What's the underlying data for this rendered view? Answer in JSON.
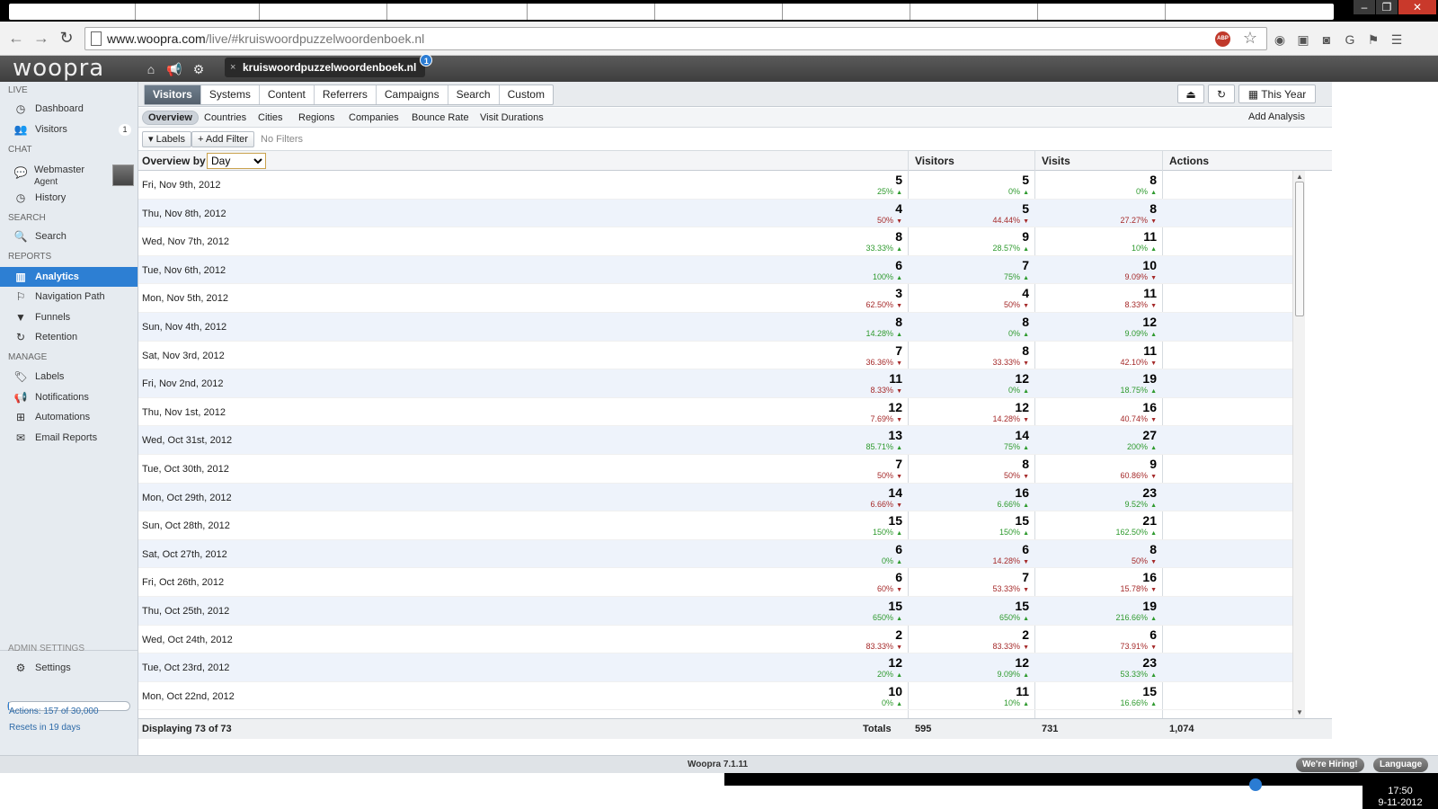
{
  "browser": {
    "url_host": "www.woopra.com",
    "url_path": "/live/#kruiswoordpuzzelwoordenboek.nl"
  },
  "app": {
    "logo": "woopra",
    "site_tab": "kruiswoordpuzzelwoordenboek.nl",
    "site_tab_badge": "1"
  },
  "sidebar": {
    "sections": {
      "live": "LIVE",
      "chat": "CHAT",
      "search": "SEARCH",
      "reports": "REPORTS",
      "manage": "MANAGE",
      "admin": "ADMIN SETTINGS"
    },
    "items": {
      "dashboard": "Dashboard",
      "visitors": "Visitors",
      "visitors_count": "1",
      "agent_line1": "Webmaster",
      "agent_line2": "Agent",
      "history": "History",
      "search": "Search",
      "analytics": "Analytics",
      "navigation_path": "Navigation Path",
      "funnels": "Funnels",
      "retention": "Retention",
      "labels": "Labels",
      "notifications": "Notifications",
      "automations": "Automations",
      "email_reports": "Email Reports",
      "settings": "Settings"
    },
    "quota": {
      "actions": "Actions: 157 of 30,000",
      "resets": "Resets in 19 days",
      "used_fraction": 0.005
    }
  },
  "tabs": {
    "visitors": "Visitors",
    "systems": "Systems",
    "content": "Content",
    "referrers": "Referrers",
    "campaigns": "Campaigns",
    "search": "Search",
    "custom": "Custom",
    "range": "This Year"
  },
  "subtabs": {
    "overview": "Overview",
    "countries": "Countries",
    "cities": "Cities",
    "regions": "Regions",
    "companies": "Companies",
    "bounce_rate": "Bounce Rate",
    "visit_durations": "Visit Durations",
    "add_analysis": "Add Analysis"
  },
  "filters": {
    "labels": "Labels",
    "add_filter": "Add Filter",
    "no_filters": "No Filters"
  },
  "table": {
    "overview_by": "Overview by",
    "group_by_selected": "Day",
    "columns": [
      "Visitors",
      "Visits",
      "Actions"
    ],
    "rows": [
      {
        "date": "Fri, Nov 9th, 2012",
        "visitors": [
          "5",
          "25%",
          "up"
        ],
        "visits": [
          "5",
          "0%",
          "up"
        ],
        "actions": [
          "8",
          "0%",
          "up"
        ]
      },
      {
        "date": "Thu, Nov 8th, 2012",
        "visitors": [
          "4",
          "50%",
          "down"
        ],
        "visits": [
          "5",
          "44.44%",
          "down"
        ],
        "actions": [
          "8",
          "27.27%",
          "down"
        ]
      },
      {
        "date": "Wed, Nov 7th, 2012",
        "visitors": [
          "8",
          "33.33%",
          "up"
        ],
        "visits": [
          "9",
          "28.57%",
          "up"
        ],
        "actions": [
          "11",
          "10%",
          "up"
        ]
      },
      {
        "date": "Tue, Nov 6th, 2012",
        "visitors": [
          "6",
          "100%",
          "up"
        ],
        "visits": [
          "7",
          "75%",
          "up"
        ],
        "actions": [
          "10",
          "9.09%",
          "down"
        ]
      },
      {
        "date": "Mon, Nov 5th, 2012",
        "visitors": [
          "3",
          "62.50%",
          "down"
        ],
        "visits": [
          "4",
          "50%",
          "down"
        ],
        "actions": [
          "11",
          "8.33%",
          "down"
        ]
      },
      {
        "date": "Sun, Nov 4th, 2012",
        "visitors": [
          "8",
          "14.28%",
          "up"
        ],
        "visits": [
          "8",
          "0%",
          "up"
        ],
        "actions": [
          "12",
          "9.09%",
          "up"
        ]
      },
      {
        "date": "Sat, Nov 3rd, 2012",
        "visitors": [
          "7",
          "36.36%",
          "down"
        ],
        "visits": [
          "8",
          "33.33%",
          "down"
        ],
        "actions": [
          "11",
          "42.10%",
          "down"
        ]
      },
      {
        "date": "Fri, Nov 2nd, 2012",
        "visitors": [
          "11",
          "8.33%",
          "down"
        ],
        "visits": [
          "12",
          "0%",
          "up"
        ],
        "actions": [
          "19",
          "18.75%",
          "up"
        ]
      },
      {
        "date": "Thu, Nov 1st, 2012",
        "visitors": [
          "12",
          "7.69%",
          "down"
        ],
        "visits": [
          "12",
          "14.28%",
          "down"
        ],
        "actions": [
          "16",
          "40.74%",
          "down"
        ]
      },
      {
        "date": "Wed, Oct 31st, 2012",
        "visitors": [
          "13",
          "85.71%",
          "up"
        ],
        "visits": [
          "14",
          "75%",
          "up"
        ],
        "actions": [
          "27",
          "200%",
          "up"
        ]
      },
      {
        "date": "Tue, Oct 30th, 2012",
        "visitors": [
          "7",
          "50%",
          "down"
        ],
        "visits": [
          "8",
          "50%",
          "down"
        ],
        "actions": [
          "9",
          "60.86%",
          "down"
        ]
      },
      {
        "date": "Mon, Oct 29th, 2012",
        "visitors": [
          "14",
          "6.66%",
          "down"
        ],
        "visits": [
          "16",
          "6.66%",
          "up"
        ],
        "actions": [
          "23",
          "9.52%",
          "up"
        ]
      },
      {
        "date": "Sun, Oct 28th, 2012",
        "visitors": [
          "15",
          "150%",
          "up"
        ],
        "visits": [
          "15",
          "150%",
          "up"
        ],
        "actions": [
          "21",
          "162.50%",
          "up"
        ]
      },
      {
        "date": "Sat, Oct 27th, 2012",
        "visitors": [
          "6",
          "0%",
          "up"
        ],
        "visits": [
          "6",
          "14.28%",
          "down"
        ],
        "actions": [
          "8",
          "50%",
          "down"
        ]
      },
      {
        "date": "Fri, Oct 26th, 2012",
        "visitors": [
          "6",
          "60%",
          "down"
        ],
        "visits": [
          "7",
          "53.33%",
          "down"
        ],
        "actions": [
          "16",
          "15.78%",
          "down"
        ]
      },
      {
        "date": "Thu, Oct 25th, 2012",
        "visitors": [
          "15",
          "650%",
          "up"
        ],
        "visits": [
          "15",
          "650%",
          "up"
        ],
        "actions": [
          "19",
          "216.66%",
          "up"
        ]
      },
      {
        "date": "Wed, Oct 24th, 2012",
        "visitors": [
          "2",
          "83.33%",
          "down"
        ],
        "visits": [
          "2",
          "83.33%",
          "down"
        ],
        "actions": [
          "6",
          "73.91%",
          "down"
        ]
      },
      {
        "date": "Tue, Oct 23rd, 2012",
        "visitors": [
          "12",
          "20%",
          "up"
        ],
        "visits": [
          "12",
          "9.09%",
          "up"
        ],
        "actions": [
          "23",
          "53.33%",
          "up"
        ]
      },
      {
        "date": "Mon, Oct 22nd, 2012",
        "visitors": [
          "10",
          "0%",
          "up"
        ],
        "visits": [
          "11",
          "10%",
          "up"
        ],
        "actions": [
          "15",
          "16.66%",
          "up"
        ]
      }
    ],
    "footer": {
      "displaying": "Displaying 73 of 73",
      "totals_label": "Totals",
      "visitors_total": "595",
      "visits_total": "731",
      "actions_total": "1,074"
    }
  },
  "footer": {
    "version": "Woopra 7.1.11",
    "hiring": "We're Hiring!",
    "language": "Language"
  },
  "taskbar": {
    "time": "17:50",
    "date": "9-11-2012"
  },
  "colors": {
    "accent": "#2d7fd3",
    "up": "#2e9a2e",
    "down": "#a52a2a"
  }
}
